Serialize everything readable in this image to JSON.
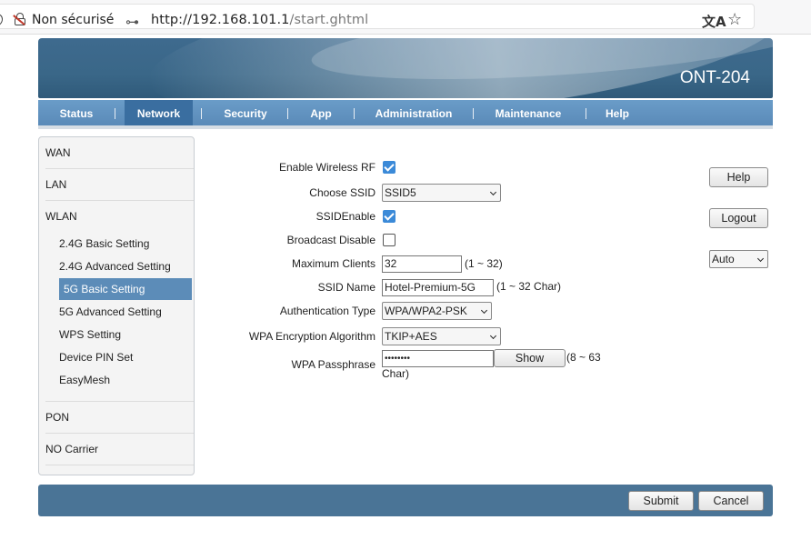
{
  "browser": {
    "security_label": "Non sécurisé",
    "url_host": "http://192.168.101.1",
    "url_path": "/start.ghtml"
  },
  "header": {
    "model": "ONT-204"
  },
  "nav": {
    "items": [
      "Status",
      "Network",
      "Security",
      "App",
      "Administration",
      "Maintenance",
      "Help"
    ],
    "active": "Network"
  },
  "sidebar": {
    "top_items": [
      "WAN",
      "LAN",
      "WLAN",
      "PON",
      "NO Carrier"
    ],
    "wlan_sub_items": [
      "2.4G Basic Setting",
      "2.4G Advanced Setting",
      "5G Basic Setting",
      "5G Advanced Setting",
      "WPS Setting",
      "Device PIN Set",
      "EasyMesh"
    ],
    "active_sub_item": "5G Basic Setting"
  },
  "form": {
    "enable_wireless_rf": {
      "label": "Enable Wireless RF",
      "checked": true
    },
    "choose_ssid": {
      "label": "Choose SSID",
      "value": "SSID5"
    },
    "ssid_enable": {
      "label": "SSIDEnable",
      "checked": true
    },
    "broadcast_disable": {
      "label": "Broadcast Disable",
      "checked": false
    },
    "maximum_clients": {
      "label": "Maximum Clients",
      "value": "32",
      "hint": "(1 ~ 32)"
    },
    "ssid_name": {
      "label": "SSID Name",
      "value": "Hotel-Premium-5G",
      "hint": "(1 ~ 32 Char)"
    },
    "authentication_type": {
      "label": "Authentication Type",
      "value": "WPA/WPA2-PSK"
    },
    "wpa_encryption": {
      "label": "WPA Encryption Algorithm",
      "value": "TKIP+AES"
    },
    "wpa_passphrase": {
      "label": "WPA Passphrase",
      "value": "••••••••",
      "show_label": "Show",
      "hint_line1": "(8 ~ 63",
      "hint_line2": "Char)"
    }
  },
  "side_buttons": {
    "help": "Help",
    "logout": "Logout",
    "language_select": "Auto"
  },
  "footer": {
    "submit": "Submit",
    "cancel": "Cancel"
  }
}
